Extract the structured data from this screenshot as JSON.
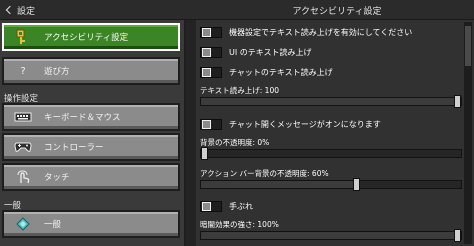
{
  "header": {
    "back_label": "設定",
    "title": "アクセシビリティ設定"
  },
  "sidebar": {
    "items": [
      {
        "label": "アクセシビリティ設定",
        "selected": true,
        "icon": "key-icon"
      },
      {
        "label": "遊び方",
        "selected": false,
        "icon": "question-icon"
      }
    ],
    "control_heading": "操作設定",
    "controls": [
      {
        "label": "キーボード＆マウス",
        "icon": "keyboard-icon"
      },
      {
        "label": "コントローラー",
        "icon": "controller-icon"
      },
      {
        "label": "タッチ",
        "icon": "touch-icon"
      }
    ],
    "general_heading": "一般",
    "general": [
      {
        "label": "一般",
        "icon": "diamond-icon"
      }
    ]
  },
  "settings": {
    "toggle_device_tts": "機器設定でテキスト読み上げを有効にしてください",
    "toggle_ui_tts": "UI のテキスト読み上げ",
    "toggle_chat_tts": "チャットのテキスト読み上げ",
    "tts_label": "テキスト読み上げ: 100",
    "tts_value": 100,
    "toggle_chat_open": "チャット開くメッセージがオンになります",
    "bg_opacity_label": "背景の不透明度: 0%",
    "bg_opacity_value": 0,
    "actionbar_opacity_label": "アクション バー背景の不透明度: 60%",
    "actionbar_opacity_value": 60,
    "toggle_camera_shake": "手ぶれ",
    "darkness_label": "暗闇効果の強さ: 100%",
    "darkness_value": 100
  },
  "colors": {
    "selected_green": "#3c8527",
    "button_grey": "#8b8b8b",
    "background": "#313131"
  }
}
